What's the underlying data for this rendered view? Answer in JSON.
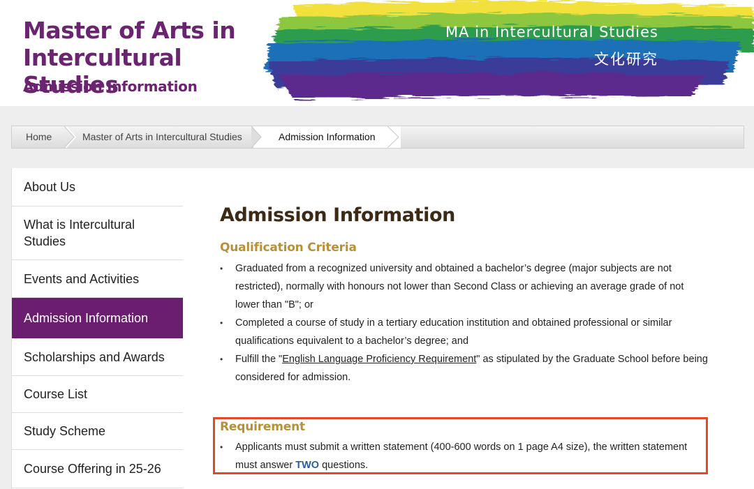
{
  "header": {
    "title_line1": "Master of Arts in",
    "title_line2": "Intercultural Studies",
    "subtitle": "Admission Information",
    "banner_en": "MA in Intercultural Studies",
    "banner_zh": "文化研究",
    "brush_colors": [
      "#f0df3a",
      "#8cc63f",
      "#2e9b4c",
      "#1f6fb8",
      "#3f3c9a",
      "#5c2a8c"
    ],
    "title_color": "#6b2470"
  },
  "breadcrumb": {
    "items": [
      "Home",
      "Master of Arts in Intercultural Studies",
      "Admission Information"
    ]
  },
  "sidebar": {
    "items": [
      {
        "label": "About Us"
      },
      {
        "label": "What is Intercultural Studies"
      },
      {
        "label": "Events and Activities"
      },
      {
        "label": "Admission Information",
        "active": true
      },
      {
        "label": "Scholarships and Awards"
      },
      {
        "label": "Course List"
      },
      {
        "label": "Study Scheme"
      },
      {
        "label": "Course Offering in 25-26"
      }
    ],
    "active_color": "#6b1d70"
  },
  "main": {
    "title": "Admission Information",
    "qualification": {
      "heading": "Qualification Criteria",
      "bullets": [
        "Graduated from a recognized university and obtained a bachelor’s degree (major subjects are not restricted), normally with honours not lower than Second Class or achieving an average grade of not lower than \"B\"; or",
        "Completed a course of study in a tertiary education institution and obtained professional or similar qualifications equivalent to a bachelor’s degree; and"
      ],
      "bullet3": {
        "prefix": "Fulfill the \"",
        "link": "English Language Proficiency Requirement",
        "suffix": "\" as stipulated by the Graduate School before being considered for admission."
      }
    },
    "requirement": {
      "heading": "Requirement",
      "prefix": "Applicants must submit a written statement (400-600 words on 1 page A4 size), the written statement must answer ",
      "emphasis": "TWO",
      "suffix": " questions.",
      "box_color": "#e04a26"
    }
  }
}
